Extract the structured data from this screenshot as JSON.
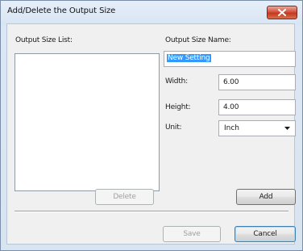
{
  "window": {
    "title": "Add/Delete the Output Size"
  },
  "list": {
    "label": "Output Size List:"
  },
  "form": {
    "name_label": "Output Size Name:",
    "name_value": "New Setting",
    "width_label": "Width:",
    "width_value": "6.00",
    "height_label": "Height:",
    "height_value": "4.00",
    "unit_label": "Unit:",
    "unit_value": "Inch"
  },
  "buttons": {
    "delete": "Delete",
    "add": "Add",
    "save": "Save",
    "cancel": "Cancel"
  },
  "icons": {
    "close": "close-icon",
    "dropdown": "chevron-down-icon"
  },
  "colors": {
    "close_button": "#c3391f",
    "selection": "#3399ff"
  }
}
